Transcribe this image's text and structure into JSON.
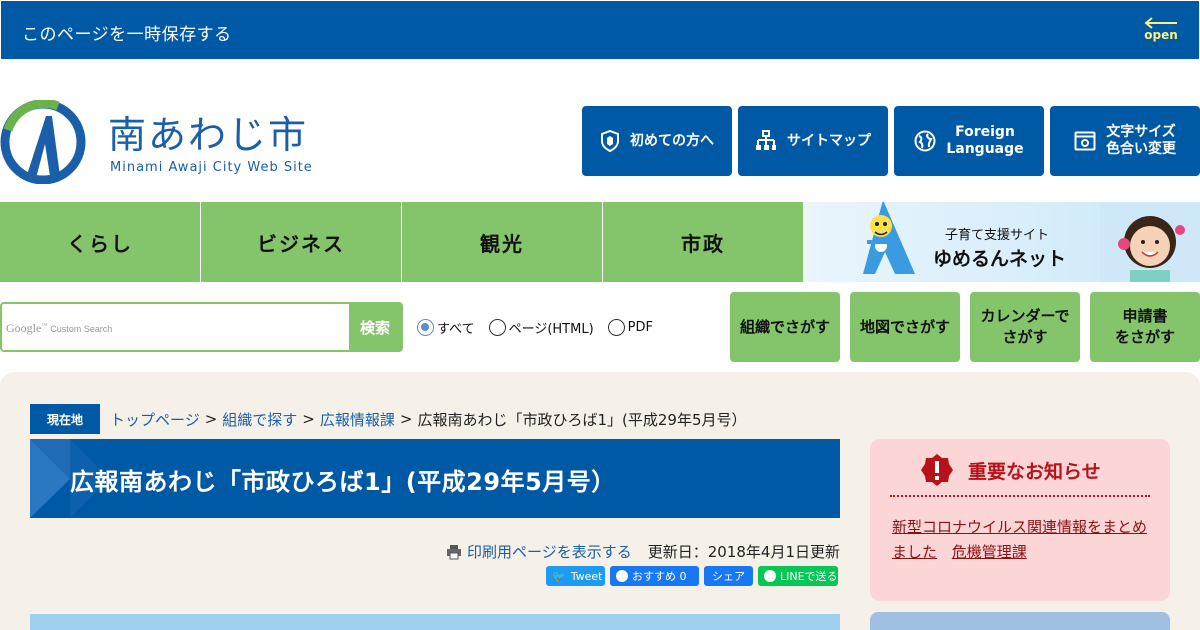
{
  "save_bar": {
    "label": "このページを一時保存する",
    "open_label": "open"
  },
  "logo": {
    "name_jp": "南あわじ市",
    "name_en": "Minami Awaji City Web Site"
  },
  "header_buttons": [
    {
      "label": "初めての方へ",
      "icon": "shield-icon"
    },
    {
      "label": "サイトマップ",
      "icon": "sitemap-icon"
    },
    {
      "label_line1": "Foreign",
      "label_line2": "Language",
      "icon": "globe-icon"
    },
    {
      "label_line1": "文字サイズ",
      "label_line2": "色合い変更",
      "icon": "settings-icon"
    }
  ],
  "global_nav": [
    "くらし",
    "ビジネス",
    "観光",
    "市政"
  ],
  "banner": {
    "line1": "子育て支援サイト",
    "line2": "ゆめるんネット"
  },
  "search": {
    "placeholder_brand": "Google",
    "placeholder_sub": "Custom Search",
    "button_label": "検索",
    "options": [
      "すべて",
      "ページ(HTML)",
      "PDF"
    ],
    "selected": "すべて"
  },
  "guide_buttons": [
    {
      "line1": "組織でさがす",
      "line2": ""
    },
    {
      "line1": "地図でさがす",
      "line2": ""
    },
    {
      "line1": "カレンダーで",
      "line2": "さがす"
    },
    {
      "line1": "申請書",
      "line2": "をさがす"
    }
  ],
  "breadcrumb": {
    "here_label": "現在地",
    "links": [
      "トップページ",
      "組織で探す",
      "広報情報課"
    ],
    "separator": ">",
    "current": "広報南あわじ「市政ひろば1」(平成29年5月号）"
  },
  "page_title": "広報南あわじ「市政ひろば1」(平成29年5月号）",
  "meta": {
    "print_label": "印刷用ページを表示する",
    "updated": "更新日：2018年4月1日更新"
  },
  "social": {
    "tweet": "Tweet",
    "recommend": "おすすめ 0",
    "share": "シェア",
    "line": "LINEで送る"
  },
  "notice": {
    "title": "重要なお知らせ",
    "link_text": "新型コロナウイルス関連情報をまとめました",
    "department": "危機管理課"
  },
  "colors": {
    "primary_blue": "#0059a5",
    "nav_green": "#84c46a",
    "notice_red": "#b5121b",
    "notice_bg": "#fcd6d7",
    "content_bg": "#f6f1e8"
  }
}
